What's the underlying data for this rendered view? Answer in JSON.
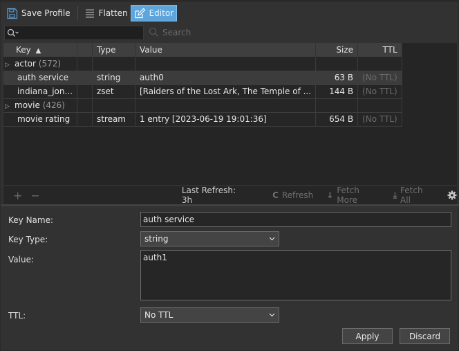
{
  "toolbar": {
    "save_profile": "Save Profile",
    "flatten": "Flatten",
    "editor": "Editor"
  },
  "search": {
    "value": "",
    "button_label": "Search"
  },
  "table": {
    "columns": [
      "Key",
      "Type",
      "Value",
      "Size",
      "TTL"
    ],
    "sort_column": "Key",
    "sort_direction": "ascending",
    "rows": [
      {
        "key": "actor",
        "count": "(572)",
        "group": true,
        "type": "",
        "value": "",
        "size": "",
        "ttl": ""
      },
      {
        "key": "auth service",
        "count": "",
        "group": false,
        "type": "string",
        "value": "auth0",
        "size": "63 B",
        "ttl": "(No TTL)",
        "selected": true
      },
      {
        "key": "indiana_jon...",
        "count": "",
        "group": false,
        "type": "zset",
        "value": "[Raiders of the Lost Ark, The Temple of ...",
        "size": "144 B",
        "ttl": "(No TTL)"
      },
      {
        "key": "movie",
        "count": "(426)",
        "group": true,
        "type": "",
        "value": "",
        "size": "",
        "ttl": ""
      },
      {
        "key": "movie rating",
        "count": "",
        "group": false,
        "type": "stream",
        "value": "1 entry [2023-06-19 19:01:36]",
        "size": "654 B",
        "ttl": "(No TTL)"
      }
    ]
  },
  "status": {
    "last_refresh": "Last Refresh: 3h",
    "refresh": "Refresh",
    "fetch_more": "Fetch More",
    "fetch_all": "Fetch All"
  },
  "editor": {
    "key_name_label": "Key Name:",
    "key_name_value": "auth service",
    "key_type_label": "Key Type:",
    "key_type_value": "string",
    "value_label": "Value:",
    "value_value": "auth1",
    "ttl_label": "TTL:",
    "ttl_value": "No TTL",
    "apply": "Apply",
    "discard": "Discard"
  },
  "colors": {
    "accent": "#5ea5dc",
    "background": "#323232",
    "table_background": "#252525"
  }
}
